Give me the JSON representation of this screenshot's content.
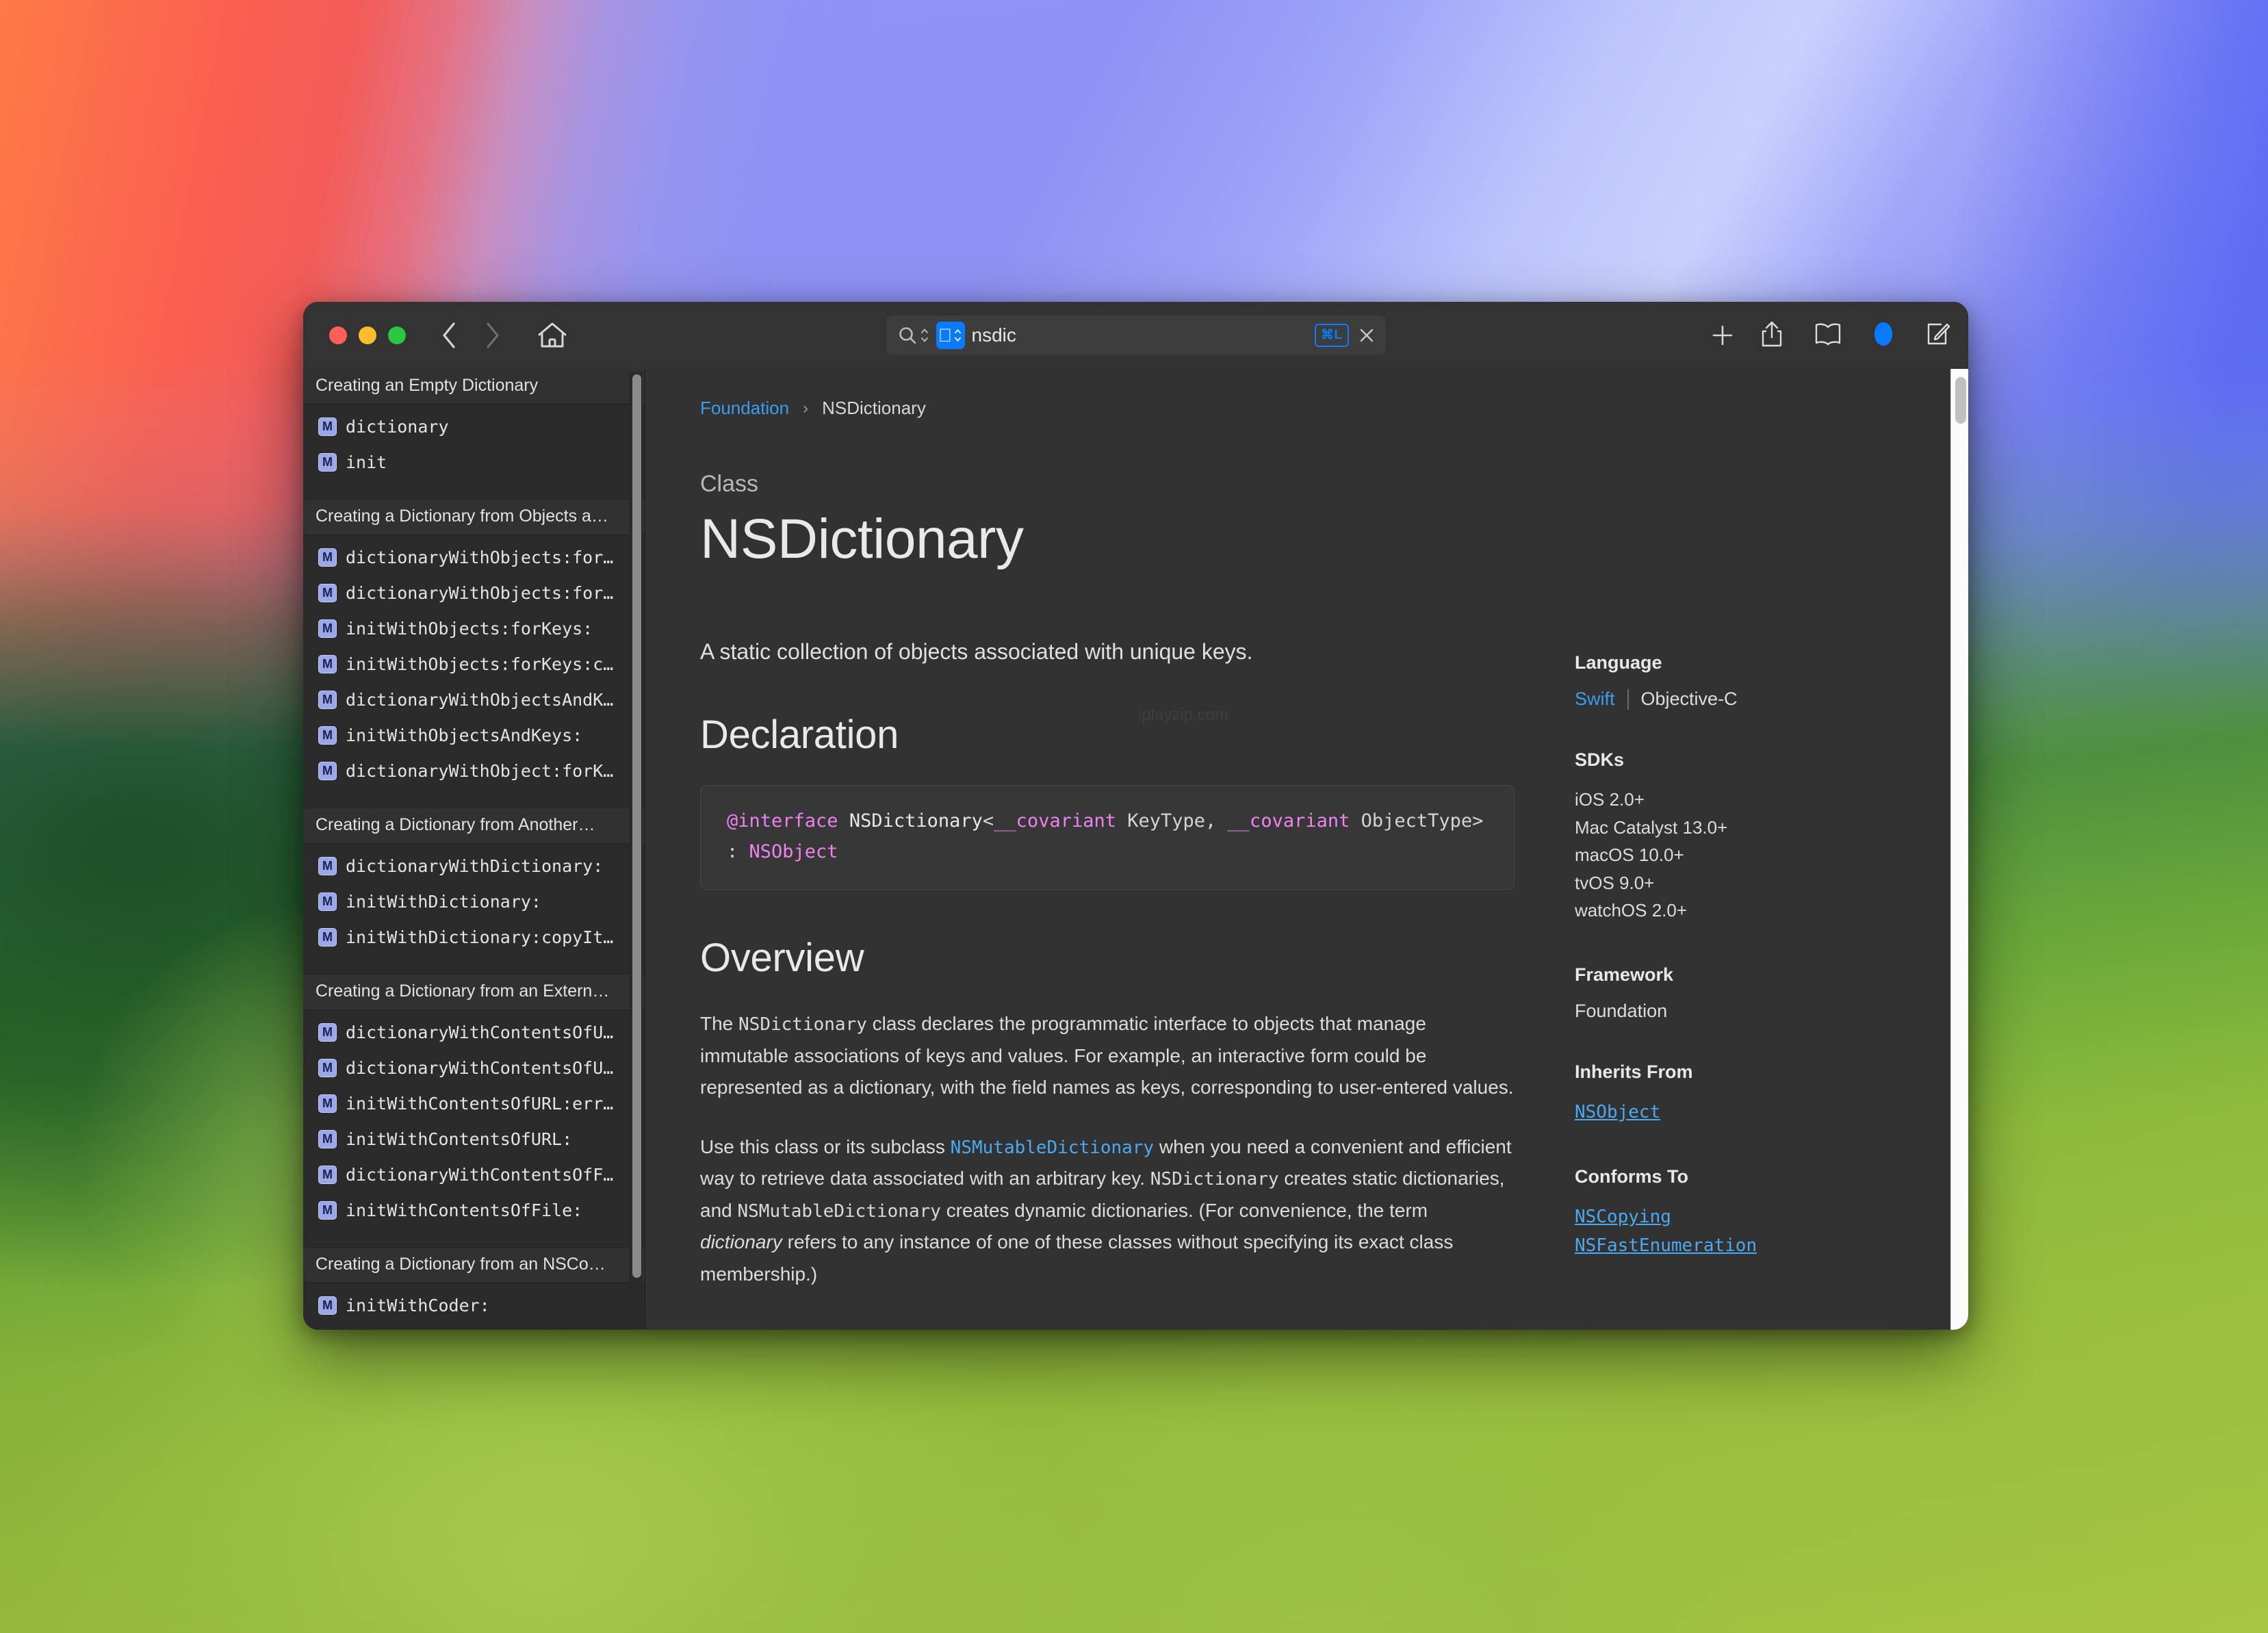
{
  "window": {
    "traffic_lights": [
      "close",
      "minimize",
      "zoom"
    ],
    "colors": {
      "accent_blue": "#0a7aff",
      "link_blue": "#3b9cf0",
      "code_pink": "#ee82ee",
      "window_bg": "#323233",
      "sidebar_bg": "#2b2b2c"
    }
  },
  "toolbar": {
    "back_label": "Back",
    "forward_label": "Forward",
    "home_label": "Home",
    "add_tab_label": "+",
    "share_label": "Share",
    "bookmarks_label": "Bookmarks",
    "appearance_label": "Appearance",
    "compose_label": "New Note",
    "search": {
      "value": "nsdic",
      "placeholder": "Search",
      "scope_icon": "apple-logo-icon",
      "shortcut_badge": "⌘L",
      "clear_label": "Clear"
    }
  },
  "sidebar": {
    "sections": [
      {
        "header": "Creating an Empty Dictionary",
        "items": [
          {
            "kind": "M",
            "label": "dictionary"
          },
          {
            "kind": "M",
            "label": "init"
          }
        ]
      },
      {
        "header": "Creating a Dictionary from Objects a…",
        "items": [
          {
            "kind": "M",
            "label": "dictionaryWithObjects:for…"
          },
          {
            "kind": "M",
            "label": "dictionaryWithObjects:for…"
          },
          {
            "kind": "M",
            "label": "initWithObjects:forKeys:"
          },
          {
            "kind": "M",
            "label": "initWithObjects:forKeys:c…"
          },
          {
            "kind": "M",
            "label": "dictionaryWithObjectsAndK…"
          },
          {
            "kind": "M",
            "label": "initWithObjectsAndKeys:"
          },
          {
            "kind": "M",
            "label": "dictionaryWithObject:forK…"
          }
        ]
      },
      {
        "header": "Creating a Dictionary from Another…",
        "items": [
          {
            "kind": "M",
            "label": "dictionaryWithDictionary:"
          },
          {
            "kind": "M",
            "label": "initWithDictionary:"
          },
          {
            "kind": "M",
            "label": "initWithDictionary:copyIt…"
          }
        ]
      },
      {
        "header": "Creating a Dictionary from an Extern…",
        "items": [
          {
            "kind": "M",
            "label": "dictionaryWithContentsOfU…"
          },
          {
            "kind": "M",
            "label": "dictionaryWithContentsOfU…"
          },
          {
            "kind": "M",
            "label": "initWithContentsOfURL:err…"
          },
          {
            "kind": "M",
            "label": "initWithContentsOfURL:"
          },
          {
            "kind": "M",
            "label": "dictionaryWithContentsOfF…"
          },
          {
            "kind": "M",
            "label": "initWithContentsOfFile:"
          }
        ]
      },
      {
        "header": "Creating a Dictionary from an NSCo…",
        "items": [
          {
            "kind": "M",
            "label": "initWithCoder:"
          }
        ]
      }
    ]
  },
  "content": {
    "breadcrumb": {
      "root": "Foundation",
      "separator": "›",
      "current": "NSDictionary"
    },
    "eyebrow": "Class",
    "title": "NSDictionary",
    "abstract": "A static collection of objects associated with unique keys.",
    "watermark": "iplayzip.com",
    "declaration": {
      "heading": "Declaration",
      "tokens": [
        {
          "t": "@interface",
          "c": "kw"
        },
        {
          "t": " ",
          "c": "plain"
        },
        {
          "t": "NSDictionary",
          "c": "tname"
        },
        {
          "t": "<",
          "c": "plain"
        },
        {
          "t": "__covariant",
          "c": "kw"
        },
        {
          "t": " KeyType, ",
          "c": "plain"
        },
        {
          "t": "__covariant",
          "c": "kw"
        },
        {
          "t": " ObjectType> : ",
          "c": "plain"
        },
        {
          "t": "NSObject",
          "c": "kw"
        }
      ],
      "text": "@interface NSDictionary<__covariant KeyType, __covariant ObjectType> : NSObject"
    },
    "overview": {
      "heading": "Overview",
      "paragraph1_a": "The ",
      "paragraph1_code": "NSDictionary",
      "paragraph1_b": " class declares the programmatic interface to objects that manage immutable associations of keys and values. For example, an interactive form could be represented as a dictionary, with the field names as keys, corresponding to user-entered values.",
      "paragraph2_a": "Use this class or its subclass ",
      "paragraph2_link": "NSMutableDictionary",
      "paragraph2_b": " when you need a convenient and efficient way to retrieve data associated with an arbitrary key. ",
      "paragraph2_code1": "NSDictionary",
      "paragraph2_c": " creates static dictionaries, and ",
      "paragraph2_code2": "NSMutableDictionary",
      "paragraph2_d": " creates dynamic dictionaries. (For convenience, the term ",
      "paragraph2_em": "dictionary",
      "paragraph2_e": " refers to any instance of one of these classes without specifying its exact class membership.)"
    }
  },
  "meta": {
    "language_heading": "Language",
    "language_active": "Swift",
    "language_other": "Objective-C",
    "sdks_heading": "SDKs",
    "sdks": [
      "iOS 2.0+",
      "Mac Catalyst 13.0+",
      "macOS 10.0+",
      "tvOS 9.0+",
      "watchOS 2.0+"
    ],
    "framework_heading": "Framework",
    "framework": "Foundation",
    "inherits_heading": "Inherits From",
    "inherits": "NSObject",
    "conforms_heading": "Conforms To",
    "conforms": [
      "NSCopying",
      "NSFastEnumeration"
    ]
  }
}
